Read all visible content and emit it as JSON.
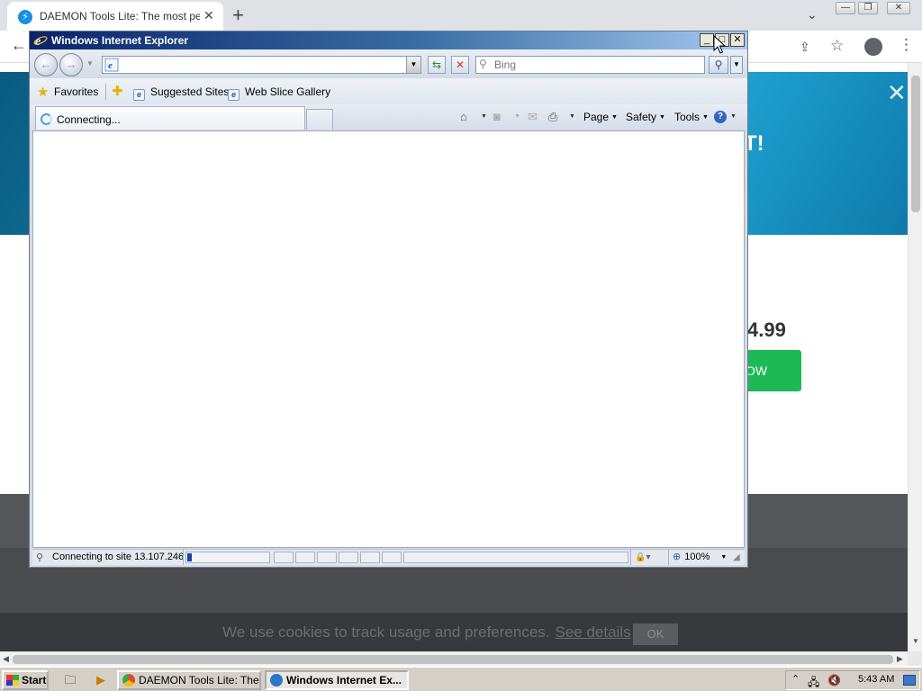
{
  "chrome": {
    "tab_title": "DAEMON Tools Lite: The most personalized",
    "tab_close": "✕",
    "new_tab": "+",
    "back": "←",
    "tab_search": "⌄",
    "win_minimize": "—",
    "win_restore": "❐",
    "win_close": "✕"
  },
  "page": {
    "banner_text": "T!",
    "banner_close": "✕",
    "price": "4.99",
    "buy_button": "OW",
    "cookie_text": "We use cookies to track usage and preferences.",
    "cookie_link": "See details",
    "cookie_ok": "OK"
  },
  "ie": {
    "title": "Windows Internet Explorer",
    "minimize": "_",
    "maximize": "□",
    "close": "✕",
    "address_value": "",
    "search_placeholder": "Bing",
    "favorites_label": "Favorites",
    "favorites": [
      {
        "label": "Suggested Sites"
      },
      {
        "label": "Web Slice Gallery"
      }
    ],
    "tab_label": "Connecting...",
    "commands": {
      "page": "Page",
      "safety": "Safety",
      "tools": "Tools",
      "help": "?"
    },
    "status_text": "Connecting to site 13.107.246",
    "progress_fraction": 0.06,
    "zoom": "100%"
  },
  "taskbar": {
    "start_label": "Start",
    "tasks": [
      {
        "label": "DAEMON Tools Lite: The ..."
      },
      {
        "label": "Windows Internet Ex..."
      }
    ],
    "clock": "5:43 AM"
  },
  "colors": {
    "ie_title_start": "#0a246a",
    "ie_title_end": "#a6caf0",
    "banner": "#1789b8",
    "buy_button": "#1db954",
    "cookie_bar": "#38393c"
  }
}
